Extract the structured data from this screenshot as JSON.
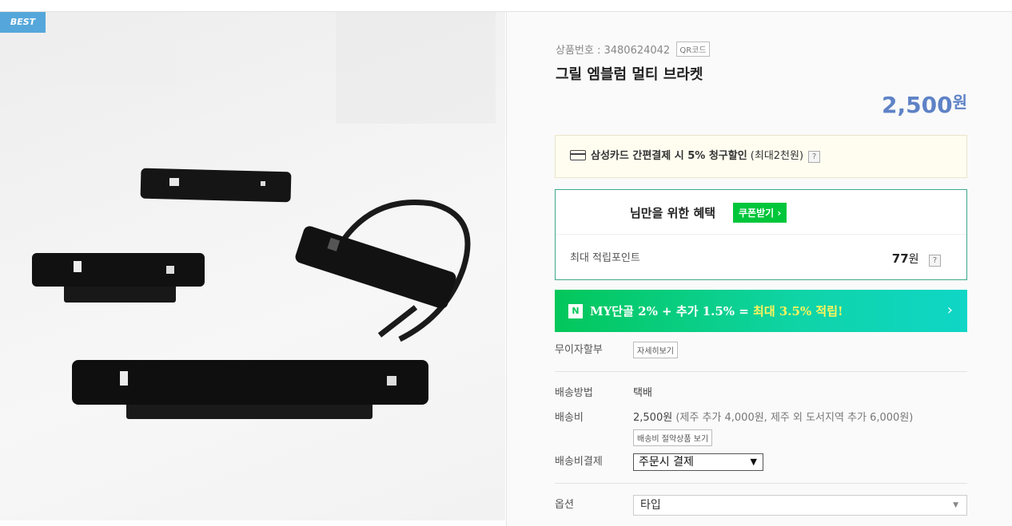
{
  "badge": "BEST",
  "product": {
    "code_label": "상품번호 : 3480624042",
    "qr_label": "QR코드",
    "title": "그릴 엠블럼 멀티 브라켓",
    "price": "2,500",
    "currency": "원"
  },
  "card_promo": {
    "text_bold": "삼성카드 간편결제 시 5% 청구할인",
    "text_sub": "(최대2천원)",
    "help": "?"
  },
  "benefit": {
    "title": "님만을 위한 혜택",
    "coupon_label": "쿠폰받기 ›",
    "points_label": "최대 적립포인트",
    "points_value": "77",
    "points_unit": "원",
    "help": "?"
  },
  "my_bar": {
    "logo": "N",
    "text_a": "MY단골 2% + 추가 1.5% = ",
    "text_b": "최대 3.5% 적립!",
    "chevron": "›"
  },
  "installment": {
    "label": "무이자할부",
    "button": "자세히보기"
  },
  "shipping": {
    "method_label": "배송방법",
    "method_value": "택배",
    "fee_label": "배송비",
    "fee_value": "2,500원",
    "fee_extra": "(제주 추가 4,000원, 제주 외 도서지역 추가 6,000원)",
    "bundle_button": "배송비 절약상품 보기",
    "pay_label": "배송비결제",
    "pay_selected": "주문시 결제",
    "pay_arrow": "▼"
  },
  "option": {
    "label": "옵션",
    "selected": "타입",
    "arrow": "▼"
  },
  "colors": {
    "price": "#5e82c6",
    "naver_green": "#03c75a",
    "badge": "#55a7db",
    "highlight": "#fff45c"
  }
}
